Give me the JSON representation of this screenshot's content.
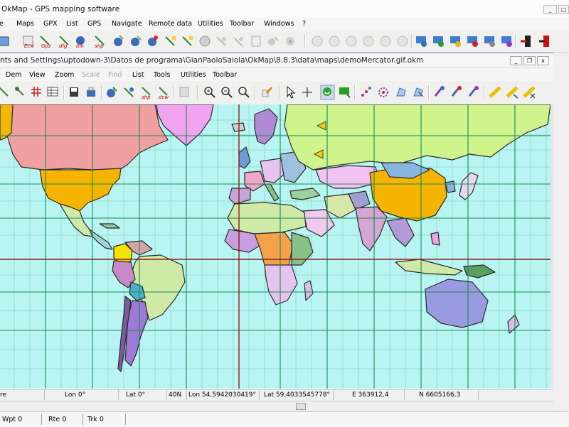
{
  "app": {
    "title": "OkMap - GPS mapping software",
    "menu": [
      "Maps",
      "GPX",
      "List",
      "GPS",
      "Navigate",
      "Remote data",
      "Utilities",
      "Toolbar",
      "Windows",
      "?"
    ],
    "window_buttons": {
      "minimize": "_",
      "maximize": "□",
      "close": "x"
    }
  },
  "toolbar_icons": [
    "map-icon",
    "gpx-ecw-icon",
    "gpx-gpz-icon",
    "waypoint-icon",
    "route-icon",
    "track-icon",
    "gps-upload-icon",
    "gps-download-icon",
    "gps-icon",
    "navigate-icon",
    "remote-data-icon",
    "satellite-icon",
    "earth-icon",
    "layers-icon",
    "print-icon",
    "export-icon",
    "settings-icon",
    "globe-icon",
    "network-icon",
    "server-icon",
    "exit-icon",
    "close-icon"
  ],
  "document": {
    "title": "nts and Settings\\uptodown-3\\Datos de programa\\GianPaoloSaiola\\OkMap\\8.8.3\\data\\maps\\demoMercator.gif.okm",
    "menu": [
      {
        "label": "Dem",
        "enabled": true
      },
      {
        "label": "View",
        "enabled": true
      },
      {
        "label": "Zoom",
        "enabled": true
      },
      {
        "label": "Scale",
        "enabled": false
      },
      {
        "label": "Find",
        "enabled": false
      },
      {
        "label": "List",
        "enabled": true
      },
      {
        "label": "Tools",
        "enabled": true
      },
      {
        "label": "Utilities",
        "enabled": true
      },
      {
        "label": "Toolbar",
        "enabled": true
      }
    ],
    "window_buttons": {
      "minimize": "_",
      "restore": "❐",
      "close": "x"
    },
    "toolbar_icons": [
      "calibrate-icon",
      "tools-icon",
      "grid-icon",
      "table-icon",
      "save-map-icon",
      "map-info-icon",
      "wpt-blue-icon",
      "rte-blue-icon",
      "shp-icon",
      "dcw-icon",
      "copy-icon",
      "zoom-in-icon",
      "zoom-out-icon",
      "zoom-fit-icon",
      "edit-icon",
      "pointer-icon",
      "cursor-icon",
      "gps-connect-icon",
      "gps-status-icon",
      "waypoint-dots-icon",
      "route-dots-icon",
      "polygon-icon",
      "measure-icon",
      "marker-purple-icon",
      "marker-blue-icon",
      "ruler-icon",
      "ruler-check-icon",
      "ruler-x-icon"
    ]
  },
  "map": {
    "name": "demoMercator.gif",
    "ocean_color": "#b8f5f2",
    "grid_color": "#1a8a52",
    "equator_color": "#8b1e1e",
    "greenwich_color": "#8b1e1e"
  },
  "status": {
    "datum": "re",
    "lon0": "Lon 0°",
    "lat0": "Lat 0°",
    "zone": "40N",
    "lon": "Lon 54,5942030419°",
    "lat": "Lat 59,4033545778°",
    "easting": "E 363912,4",
    "northing": "N 6605166,3"
  },
  "app_status": {
    "wpt": "Wpt 0",
    "rte": "Rte 0",
    "trk": "Trk 0"
  }
}
